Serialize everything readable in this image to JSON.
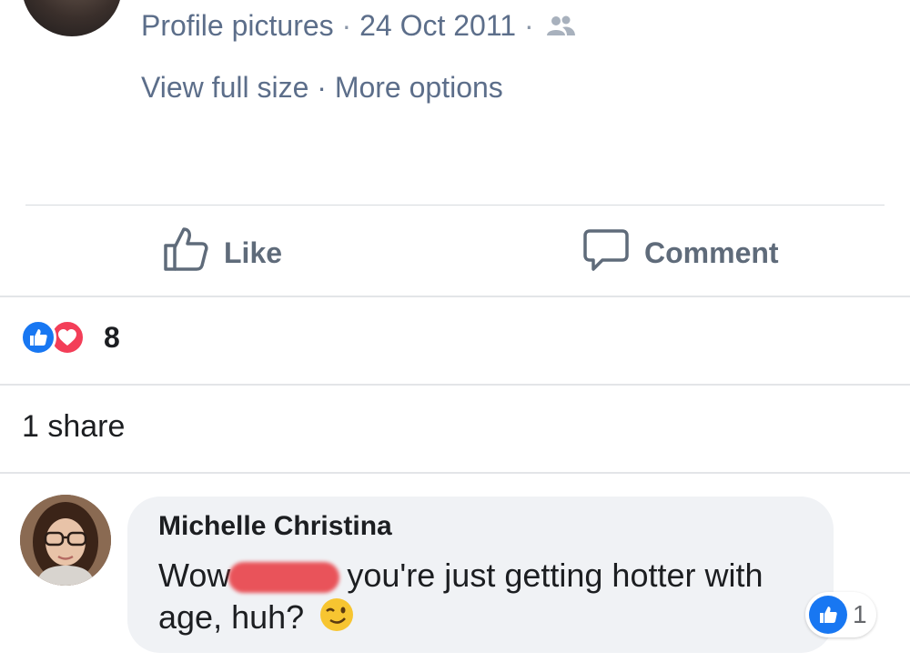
{
  "post": {
    "album": "Profile pictures",
    "separator": "·",
    "date": "24 Oct 2011",
    "audience_icon": "friends-icon",
    "view_full_size": "View full size",
    "more_options": "More options"
  },
  "actions": {
    "like_label": "Like",
    "comment_label": "Comment"
  },
  "reactions": {
    "types": [
      "like",
      "love"
    ],
    "count": "8"
  },
  "shares": {
    "label": "1 share"
  },
  "comment": {
    "author": "Michelle Christina",
    "text_before_redaction": "Wow",
    "text_after_redaction": "you're just getting hotter with age, huh?",
    "emoji": "winking-face-icon",
    "reaction_count": "1"
  },
  "colors": {
    "link_gray": "#5c6e8a",
    "like_blue": "#1877f2",
    "love_red": "#f33e58",
    "bubble_bg": "#f0f2f5"
  }
}
